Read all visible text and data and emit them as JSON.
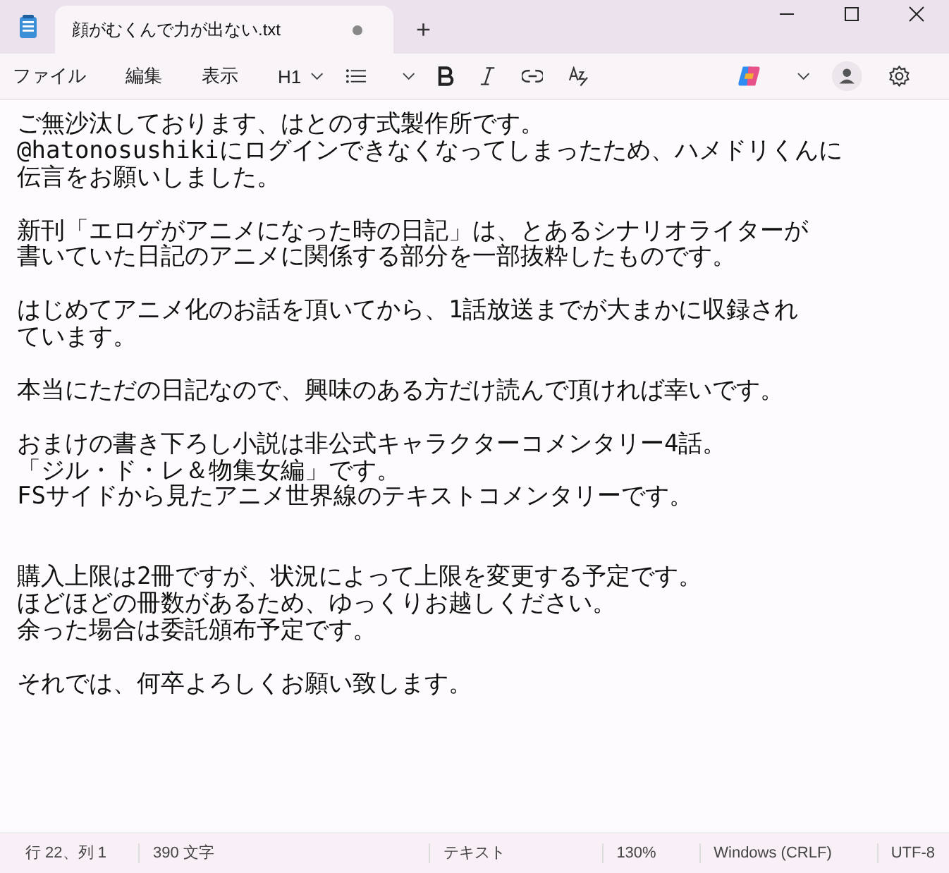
{
  "window": {
    "tab_title": "顔がむくんで力が出ない.txt",
    "unsaved": true,
    "new_tab": "+"
  },
  "menu": [
    {
      "label": "ファイル"
    },
    {
      "label": "編集"
    },
    {
      "label": "表示"
    }
  ],
  "toolbar": {
    "heading": "H1"
  },
  "lines": [
    {
      "kind": "text",
      "text": "ご無沙汰しております、はとのす式製作所です。"
    },
    {
      "kind": "text",
      "text": "@hatonosushikiにログインできなくなってしまったため、ハメドリくんに"
    },
    {
      "kind": "text",
      "text": "伝言をお願いしました。"
    },
    {
      "kind": "blank"
    },
    {
      "kind": "text",
      "text": "新刊「エロゲがアニメになった時の日記」は、とあるシナリオライターが"
    },
    {
      "kind": "text",
      "text": "書いていた日記のアニメに関係する部分を一部抜粋したものです。"
    },
    {
      "kind": "blank"
    },
    {
      "kind": "text",
      "text": "はじめてアニメ化のお話を頂いてから、1話放送までが大まかに収録され"
    },
    {
      "kind": "text",
      "text": "ています。"
    },
    {
      "kind": "blank"
    },
    {
      "kind": "text",
      "text": "本当にただの日記なので、興味のある方だけ読んで頂ければ幸いです。"
    },
    {
      "kind": "blank"
    },
    {
      "kind": "text",
      "text": "おまけの書き下ろし小説は非公式キャラクターコメンタリー4話。"
    },
    {
      "kind": "text",
      "text": "「ジル・ド・レ＆物集女編」です。"
    },
    {
      "kind": "text",
      "text": "FSサイドから見たアニメ世界線のテキストコメンタリーです。"
    },
    {
      "kind": "blank"
    },
    {
      "kind": "blank"
    },
    {
      "kind": "text",
      "text": "購入上限は2冊ですが、状況によって上限を変更する予定です。"
    },
    {
      "kind": "text",
      "text": "ほどほどの冊数があるため、ゆっくりお越しください。"
    },
    {
      "kind": "text",
      "text": "余った場合は委託頒布予定です。"
    },
    {
      "kind": "blank"
    },
    {
      "kind": "text",
      "text": "それでは、何卒よろしくお願い致します。"
    }
  ],
  "status_bar": [
    {
      "text": "行 22、列 1"
    },
    {
      "text": "390 文字"
    },
    {
      "text": "テキスト"
    },
    {
      "text": "130%"
    },
    {
      "text": "Windows (CRLF)"
    },
    {
      "text": "UTF-8"
    }
  ]
}
